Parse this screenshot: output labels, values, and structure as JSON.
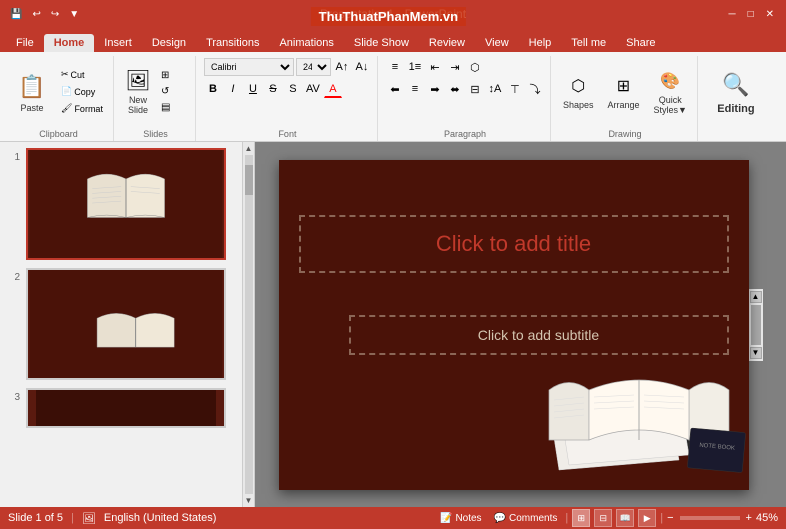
{
  "titlebar": {
    "title": "Presentation1 - PowerPoint",
    "watermark": "ThuThuatPhanMem.vn"
  },
  "ribbon_tabs": {
    "tabs": [
      "File",
      "Home",
      "Insert",
      "Design",
      "Transitions",
      "Animations",
      "Slide Show",
      "Review",
      "View",
      "Help",
      "Tell me",
      "Share"
    ],
    "active": "Home"
  },
  "ribbon": {
    "groups": {
      "clipboard": {
        "label": "Clipboard",
        "paste": "Paste"
      },
      "slides": {
        "label": "Slides",
        "new_slide": "New\nSlide"
      },
      "font": {
        "label": "Font",
        "bold": "B",
        "italic": "I",
        "underline": "U",
        "strikethrough": "S"
      },
      "paragraph": {
        "label": "Paragraph"
      },
      "drawing": {
        "label": "Drawing",
        "shapes": "Shapes",
        "arrange": "Arrange",
        "quick_styles": "Quick\nStyles"
      },
      "editing": {
        "label": "Editing"
      }
    }
  },
  "slides": [
    {
      "num": "1",
      "selected": true
    },
    {
      "num": "2",
      "selected": false
    },
    {
      "num": "3",
      "selected": false
    }
  ],
  "canvas": {
    "title_placeholder": "Click to add title",
    "subtitle_placeholder": "Click to add subtitle"
  },
  "statusbar": {
    "slide_info": "Slide 1 of 5",
    "language": "English (United States)",
    "notes": "Notes",
    "comments": "Comments",
    "zoom": "45%"
  }
}
